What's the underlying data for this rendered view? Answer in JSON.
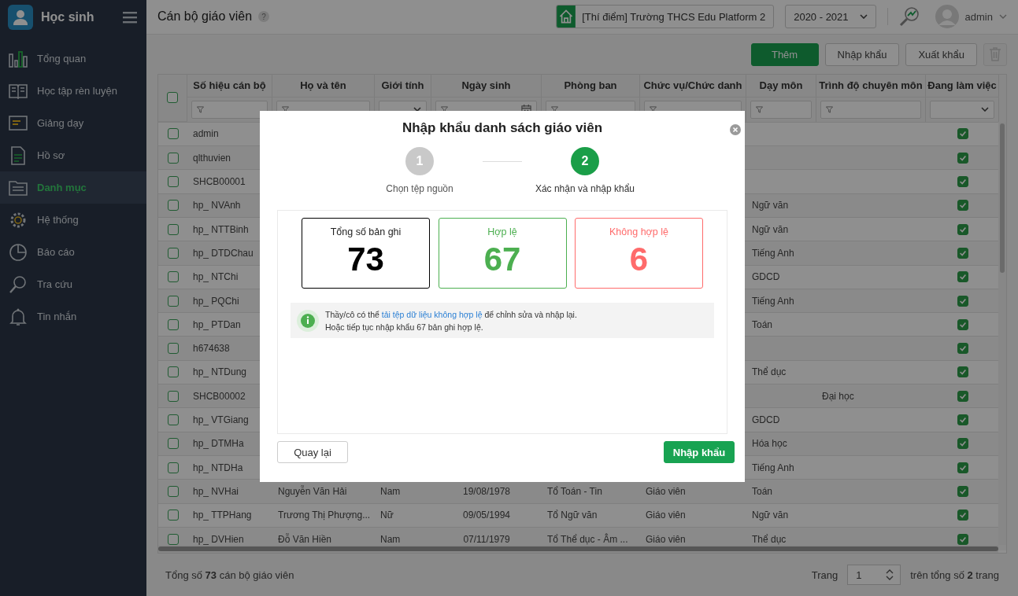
{
  "app": {
    "name": "Học sinh"
  },
  "sidebar": {
    "items": [
      {
        "label": "Tổng quan",
        "selected": false
      },
      {
        "label": "Học tập rèn luyện",
        "selected": false
      },
      {
        "label": "Giảng dạy",
        "selected": false
      },
      {
        "label": "Hồ sơ",
        "selected": false
      },
      {
        "label": "Danh mục",
        "selected": true
      },
      {
        "label": "Hệ thống",
        "selected": false
      },
      {
        "label": "Báo cáo",
        "selected": false
      },
      {
        "label": "Tra cứu",
        "selected": false
      },
      {
        "label": "Tin nhắn",
        "selected": false
      }
    ]
  },
  "header": {
    "title": "Cán bộ giáo viên",
    "help": "?",
    "school": "[Thí điểm] Trường THCS Edu Platform 2",
    "year": "2020 - 2021",
    "user": "admin"
  },
  "toolbar": {
    "buttons": [
      {
        "kind": "primary",
        "label": "Thêm"
      },
      {
        "kind": "default",
        "label": "Nhập khẩu"
      },
      {
        "kind": "default",
        "label": "Xuất khẩu"
      },
      {
        "kind": "delete",
        "disabled": true
      }
    ]
  },
  "table": {
    "select_all": {
      "checked": false
    },
    "columns": [
      {
        "label": "Số hiệu cán bộ",
        "kind": "text"
      },
      {
        "label": "Họ và tên",
        "kind": "text"
      },
      {
        "label": "Giới tính",
        "kind": "select"
      },
      {
        "label": "Ngày sinh",
        "kind": "date"
      },
      {
        "label": "Phòng ban",
        "kind": "text"
      },
      {
        "label": "Chức vụ/Chức danh",
        "kind": "text"
      },
      {
        "label": "Dạy môn",
        "kind": "text"
      },
      {
        "label": "Trình độ chuyên môn",
        "kind": "text"
      },
      {
        "label": "Đang làm việc",
        "kind": "select"
      }
    ],
    "rows": [
      {
        "checked": false,
        "cells": [
          "admin",
          "",
          "",
          "",
          "",
          "",
          "",
          "",
          ""
        ],
        "working": true
      },
      {
        "checked": false,
        "cells": [
          "qlthuvien",
          "",
          "",
          "",
          "",
          "",
          "",
          "",
          ""
        ],
        "working": true
      },
      {
        "checked": false,
        "cells": [
          "SHCB00001",
          "",
          "",
          "",
          "",
          "",
          "",
          "",
          ""
        ],
        "working": true
      },
      {
        "checked": false,
        "cells": [
          "hp_ NVAnh",
          "",
          "",
          "",
          "",
          "",
          "Ngữ văn",
          ""
        ],
        "working": true
      },
      {
        "checked": false,
        "cells": [
          "hp_ NTTBinh",
          "",
          "",
          "",
          "",
          "",
          "Ngữ văn",
          ""
        ],
        "working": true
      },
      {
        "checked": false,
        "cells": [
          "hp_ DTDChau",
          "",
          "",
          "",
          "",
          "",
          "Tiếng Anh",
          ""
        ],
        "working": true
      },
      {
        "checked": false,
        "cells": [
          "hp_ NTChi",
          "",
          "",
          "",
          "",
          "",
          "GDCD",
          ""
        ],
        "working": true
      },
      {
        "checked": false,
        "cells": [
          "hp_ PQChi",
          "",
          "",
          "",
          "",
          "",
          "Tiếng Anh",
          ""
        ],
        "working": true
      },
      {
        "checked": false,
        "cells": [
          "hp_ PTDan",
          "",
          "",
          "",
          "",
          "",
          "Toán",
          ""
        ],
        "working": true
      },
      {
        "checked": false,
        "cells": [
          "h674638",
          "",
          "",
          "",
          "",
          "",
          "",
          ""
        ],
        "working": true
      },
      {
        "checked": false,
        "cells": [
          "hp_ NTDung",
          "",
          "",
          "",
          "",
          "",
          "Thể dục",
          ""
        ],
        "working": true
      },
      {
        "checked": false,
        "cells": [
          "SHCB00002",
          "",
          "",
          "",
          "",
          "",
          "",
          "Đại học"
        ],
        "working": true
      },
      {
        "checked": false,
        "cells": [
          "hp_ VTGiang",
          "",
          "",
          "",
          "",
          "",
          "GDCD",
          ""
        ],
        "working": true
      },
      {
        "checked": false,
        "cells": [
          "hp_ DTMHa",
          "",
          "",
          "",
          "",
          "",
          "Hóa học",
          ""
        ],
        "working": true
      },
      {
        "checked": false,
        "cells": [
          "hp_ NTDHa",
          "",
          "",
          "",
          "",
          "",
          "Tiếng Anh",
          ""
        ],
        "working": true
      },
      {
        "checked": false,
        "cells": [
          "hp_ NVHai",
          "Nguyễn Văn Hải",
          "Nam",
          "19/08/1978",
          "Tổ Toán - Tin",
          "Giáo viên",
          "Toán",
          ""
        ],
        "working": true
      },
      {
        "checked": false,
        "cells": [
          "hp_ TTPHang",
          "Trương Thị Phượng...",
          "Nữ",
          "09/05/1994",
          "Tổ Ngữ văn",
          "Giáo viên",
          "Ngữ văn",
          ""
        ],
        "working": true
      },
      {
        "checked": false,
        "cells": [
          "hp_ DVHien",
          "Đỗ Văn Hiền",
          "Nam",
          "07/11/1979",
          "Tổ Thể dục - Âm ...",
          "Giáo viên",
          "Thể dục",
          ""
        ],
        "working": true
      }
    ]
  },
  "footer": {
    "total": "Tổng số **73** cán bộ giáo viên",
    "page_label": "Trang",
    "page": "1",
    "page_total": "trên tổng số **2** trang"
  },
  "modal": {
    "title": "Nhập khẩu danh sách giáo viên",
    "steps": [
      {
        "number": "1",
        "label": "Chọn tệp nguồn",
        "selected": false
      },
      {
        "number": "2",
        "label": "Xác nhận và nhập khẩu",
        "selected": true
      }
    ],
    "cards": [
      {
        "label": "Tổng số bản ghi",
        "value": "73",
        "color": "#000000"
      },
      {
        "label": "Hợp lệ",
        "value": "67",
        "color": "#4caf50"
      },
      {
        "label": "Không hợp lệ",
        "value": "6",
        "color": "#ff6b6b"
      }
    ],
    "info": {
      "before": "Thầy/cô có thể ",
      "link": "tải tệp dữ liệu không hợp lệ",
      "after": " để chỉnh sửa và nhập lại.",
      "line2": "Hoặc tiếp tục nhập khẩu 67 bản ghi hợp lệ."
    },
    "buttons": [
      {
        "kind": "default",
        "label": "Quay lại"
      },
      {
        "kind": "primary",
        "label": "Nhập khẩu"
      }
    ]
  }
}
